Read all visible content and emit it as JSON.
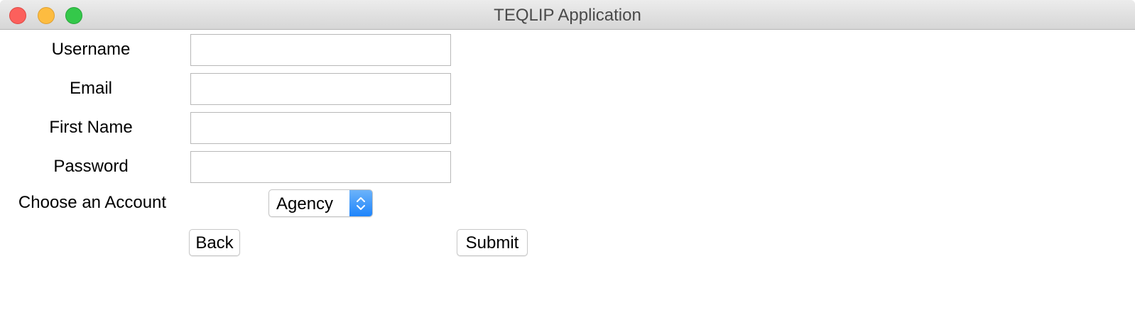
{
  "window": {
    "title": "TEQLIP Application"
  },
  "form": {
    "username_label": "Username",
    "email_label": "Email",
    "first_name_label": "First Name",
    "password_label": "Password",
    "account_label": "Choose an Account",
    "username_value": "",
    "email_value": "",
    "first_name_value": "",
    "password_value": "",
    "account_selected": "Agency"
  },
  "buttons": {
    "back_label": "Back",
    "submit_label": "Submit"
  },
  "colors": {
    "select_accent": "#1a82fb",
    "close": "#fc605c",
    "minimize": "#fdbc40",
    "maximize": "#34c84a"
  }
}
